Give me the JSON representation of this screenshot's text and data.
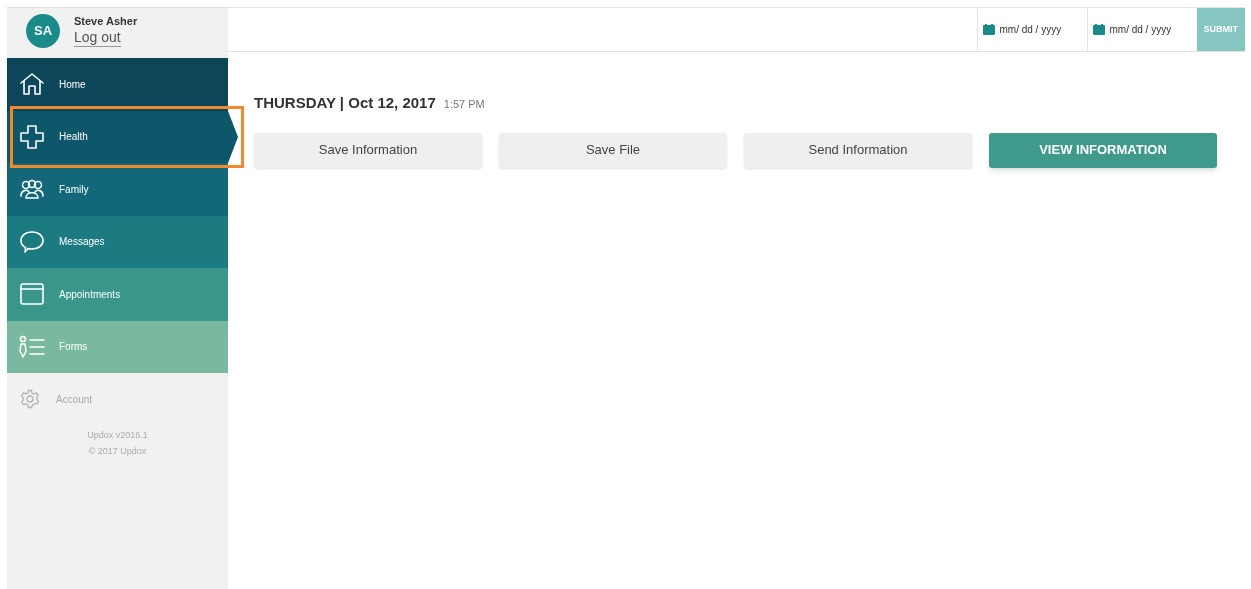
{
  "user": {
    "initials": "SA",
    "name": "Steve Asher",
    "logout": "Log out"
  },
  "nav": [
    {
      "label": "Home",
      "selected": false,
      "highlighted": false,
      "color": "#0c4658"
    },
    {
      "label": "Health",
      "selected": true,
      "highlighted": true,
      "color": "#0e5669"
    },
    {
      "label": "Family",
      "selected": false,
      "highlighted": false,
      "color": "#126878"
    },
    {
      "label": "Messages",
      "selected": false,
      "highlighted": false,
      "color": "#1c7b80"
    },
    {
      "label": "Appointments",
      "selected": false,
      "highlighted": false,
      "color": "#3a968a"
    },
    {
      "label": "Forms",
      "selected": false,
      "highlighted": false,
      "color": "#79b99f"
    }
  ],
  "account": "Account",
  "version": "Updox v2016.1",
  "copyright": "© 2017 Updox",
  "date_filter": {
    "fields": [
      {
        "placeholder": "mm/ dd / yyyy"
      },
      {
        "placeholder": "mm/ dd / yyyy"
      }
    ],
    "submit": "SUBMIT"
  },
  "heading": {
    "date": "THURSDAY | Oct 12, 2017",
    "time": "1:57 PM"
  },
  "actions": [
    {
      "label": "Save Information",
      "kind": "secondary"
    },
    {
      "label": "Save File",
      "kind": "secondary"
    },
    {
      "label": "Send Information",
      "kind": "secondary"
    },
    {
      "label": "VIEW INFORMATION",
      "kind": "primary"
    }
  ]
}
